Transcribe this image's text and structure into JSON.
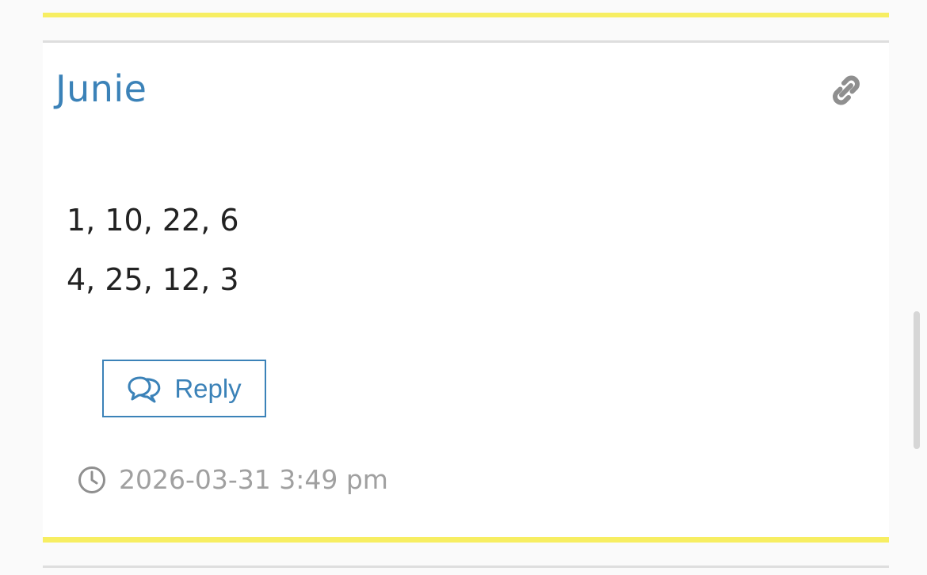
{
  "comment": {
    "author": "Junie",
    "lines": [
      "1, 10, 22, 6",
      "4, 25, 12, 3"
    ],
    "reply_label": "Reply",
    "timestamp": "2026-03-31 3:49 pm"
  },
  "icons": {
    "permalink": "link-icon",
    "reply": "chat-bubbles-icon",
    "timestamp": "clock-icon"
  },
  "colors": {
    "accent": "#3b82b8",
    "highlight_rule": "#f7ee62",
    "divider": "#dedede",
    "body_text": "#222222",
    "meta_text": "#a0a0a0",
    "link_icon": "#8f8f8f"
  }
}
